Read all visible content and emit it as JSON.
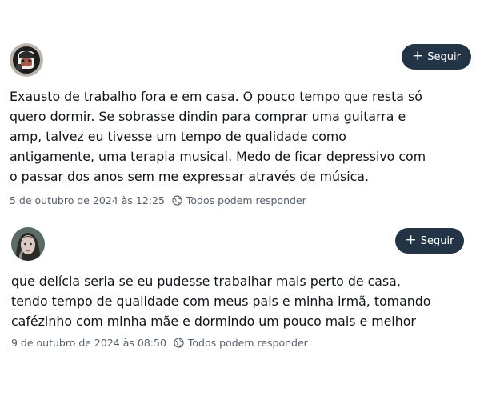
{
  "posts": [
    {
      "follow_label": "Seguir",
      "text": "Exausto de trabalho fora e em casa. O pouco tempo que resta só\nquero dormir. Se sobrasse dindin para comprar uma guitarra e\namp, talvez eu tivesse um tempo de qualidade como\nantigamente, uma terapia musical. Medo de ficar depressivo com\no passar dos anos sem me expressar através de música.",
      "date": "5 de outubro de 2024 às 12:25",
      "reply_setting": "Todos podem responder"
    },
    {
      "follow_label": "Seguir",
      "text": "que delícia seria se eu pudesse trabalhar mais perto de casa,\ntendo tempo de qualidade com meus pais e minha irmã, tomando\ncafézinho com minha mãe e dormindo um pouco mais e melhor",
      "date": "9 de outubro de 2024 às 08:50",
      "reply_setting": "Todos podem responder"
    }
  ],
  "colors": {
    "button_bg": "#243447",
    "button_text": "#ffffff",
    "body_text": "#0f1419",
    "meta_text": "#55606c"
  },
  "icons": {
    "follow": "plus-icon",
    "reply_setting": "globe-icon"
  }
}
